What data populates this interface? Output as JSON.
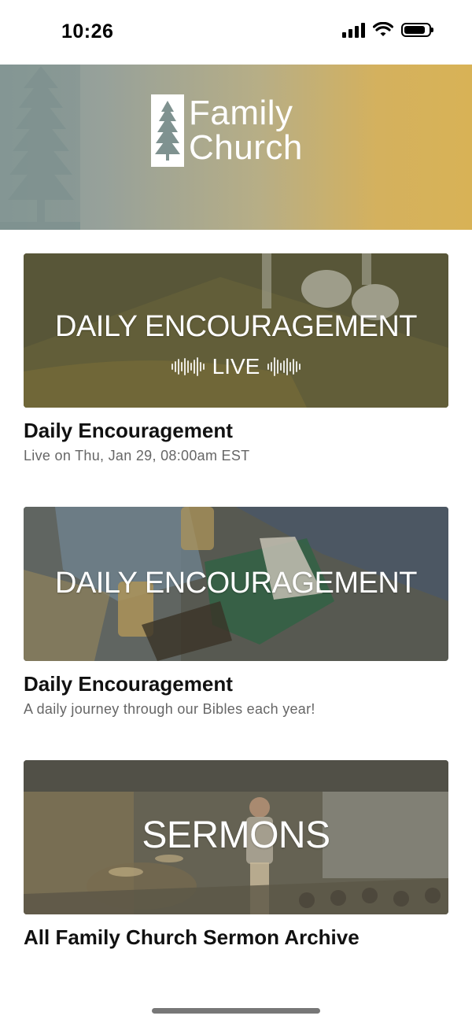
{
  "status_bar": {
    "time": "10:26",
    "battery_level": 0.85
  },
  "header": {
    "logo_line1": "Family",
    "logo_line2": "Church",
    "icon": "pine-tree-icon"
  },
  "cards": [
    {
      "overlay_title": "DAILY ENCOURAGEMENT",
      "live_label": "LIVE",
      "title": "Daily Encouragement",
      "subtitle": "Live on Thu, Jan 29, 08:00am EST"
    },
    {
      "overlay_title": "DAILY ENCOURAGEMENT",
      "title": "Daily Encouragement",
      "subtitle": "A daily journey through our Bibles each year!"
    },
    {
      "overlay_title": "SERMONS",
      "title": "All Family Church Sermon Archive"
    }
  ],
  "colors": {
    "banner_left": "#8a9c99",
    "banner_right": "#d8b256",
    "text_primary": "#111111",
    "text_secondary": "#666666"
  }
}
